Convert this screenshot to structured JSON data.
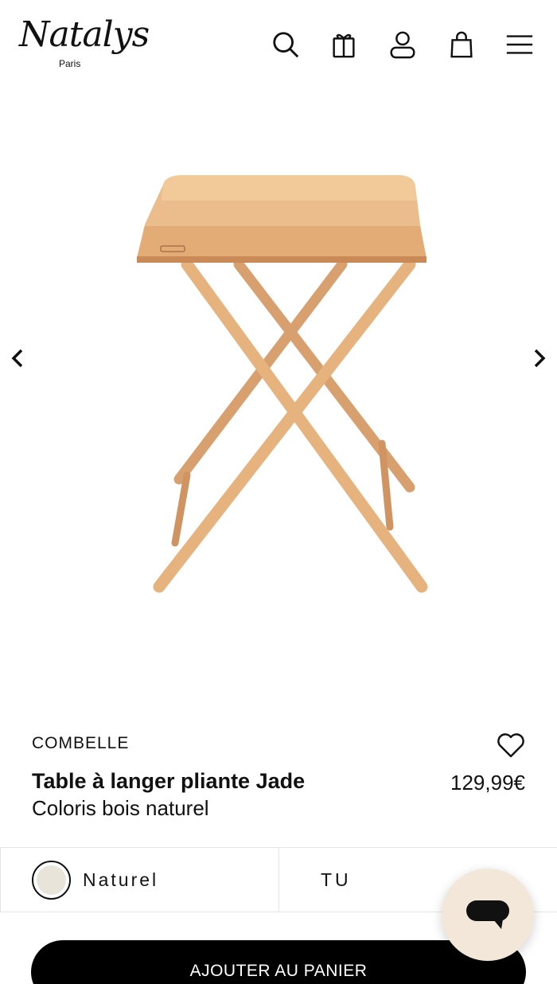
{
  "header": {
    "logo_text": "Natalys",
    "logo_sub": "Paris",
    "icons": [
      "search-icon",
      "gift-icon",
      "user-icon",
      "bag-icon",
      "menu-icon"
    ]
  },
  "gallery": {
    "prev_icon": "chevron-left-icon",
    "next_icon": "chevron-right-icon"
  },
  "product": {
    "brand": "COMBELLE",
    "title": "Table à langer pliante Jade",
    "subtitle": "Coloris bois naturel",
    "price": "129,99€"
  },
  "variants": {
    "color_label": "Naturel",
    "color_swatch": "#e8e4da",
    "size_label": "TU"
  },
  "cart": {
    "button_label": "AJOUTER AU PANIER"
  },
  "colors": {
    "wood_light": "#e9b98a",
    "wood_dark": "#c98a57",
    "chat_bg": "#f3e7da",
    "button_bg": "#000000"
  }
}
